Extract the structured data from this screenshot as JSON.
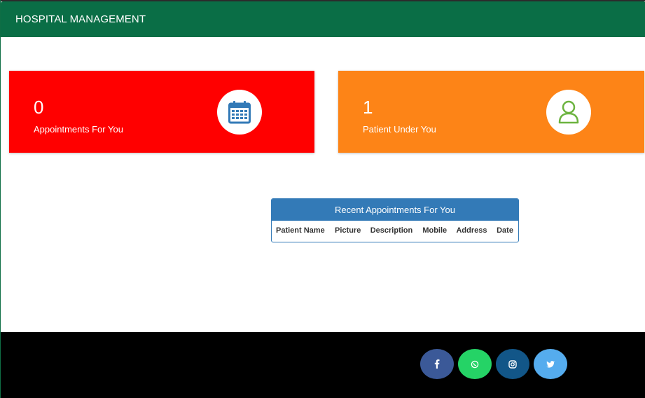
{
  "navbar": {
    "brand": "HOSPITAL MANAGEMENT"
  },
  "cards": [
    {
      "count": "0",
      "caption": "Appointments For You",
      "icon": "calendar-icon",
      "color": "#ff0000",
      "icon_color": "#337ab7"
    },
    {
      "count": "1",
      "caption": "Patient Under You",
      "icon": "user-icon",
      "color": "#fd8417",
      "icon_color": "#5cb85c"
    }
  ],
  "appointments_panel": {
    "title": "Recent Appointments For You",
    "columns": [
      "Patient Name",
      "Picture",
      "Description",
      "Mobile",
      "Address",
      "Date"
    ],
    "rows": []
  },
  "footer": {
    "social": [
      {
        "name": "facebook",
        "glyph": "f",
        "color": "#3b5998"
      },
      {
        "name": "whatsapp",
        "glyph": "✆",
        "color": "#25d366"
      },
      {
        "name": "instagram",
        "glyph": "◎",
        "color": "#125688"
      },
      {
        "name": "twitter",
        "glyph": "🐦",
        "color": "#55acee"
      }
    ]
  }
}
